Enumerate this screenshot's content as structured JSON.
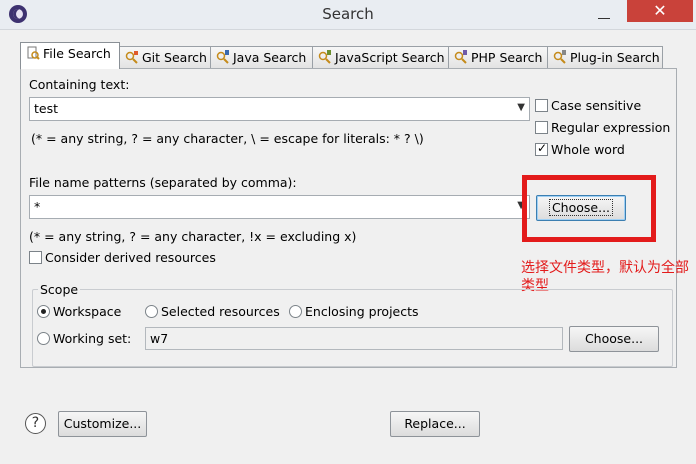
{
  "window": {
    "title": "Search",
    "close_glyph": "✕"
  },
  "tabs": [
    {
      "label": "File Search",
      "icon": "file-search-icon",
      "active": true
    },
    {
      "label": "Git Search",
      "icon": "git-search-icon"
    },
    {
      "label": "Java Search",
      "icon": "java-search-icon"
    },
    {
      "label": "JavaScript Search",
      "icon": "javascript-search-icon"
    },
    {
      "label": "PHP Search",
      "icon": "php-search-icon"
    },
    {
      "label": "Plug-in Search",
      "icon": "plugin-search-icon"
    }
  ],
  "containing": {
    "label": "Containing text:",
    "value": "test",
    "hint": "(* = any string, ? = any character, \\ = escape for literals: * ? \\)"
  },
  "options": {
    "case_sensitive": {
      "label": "Case sensitive",
      "checked": false
    },
    "regex": {
      "label": "Regular expression",
      "checked": false
    },
    "whole_word": {
      "label": "Whole word",
      "checked": true
    }
  },
  "patterns": {
    "label": "File name patterns (separated by comma):",
    "value": "*",
    "choose_label": "Choose...",
    "hint": "(* = any string, ? = any character, !x = excluding x)"
  },
  "derived": {
    "label": "Consider derived resources",
    "checked": false
  },
  "scope": {
    "legend": "Scope",
    "workspace": "Workspace",
    "selected": "Selected resources",
    "enclosing": "Enclosing projects",
    "working_set": "Working set:",
    "working_set_value": "w7",
    "choose_label": "Choose...",
    "selected_option": "Workspace"
  },
  "annotation": {
    "text": "选择文件类型，默认为全部类型",
    "color": "#e31b1b"
  },
  "footer": {
    "help_glyph": "?",
    "customize_label": "Customize...",
    "replace_label": "Replace..."
  }
}
